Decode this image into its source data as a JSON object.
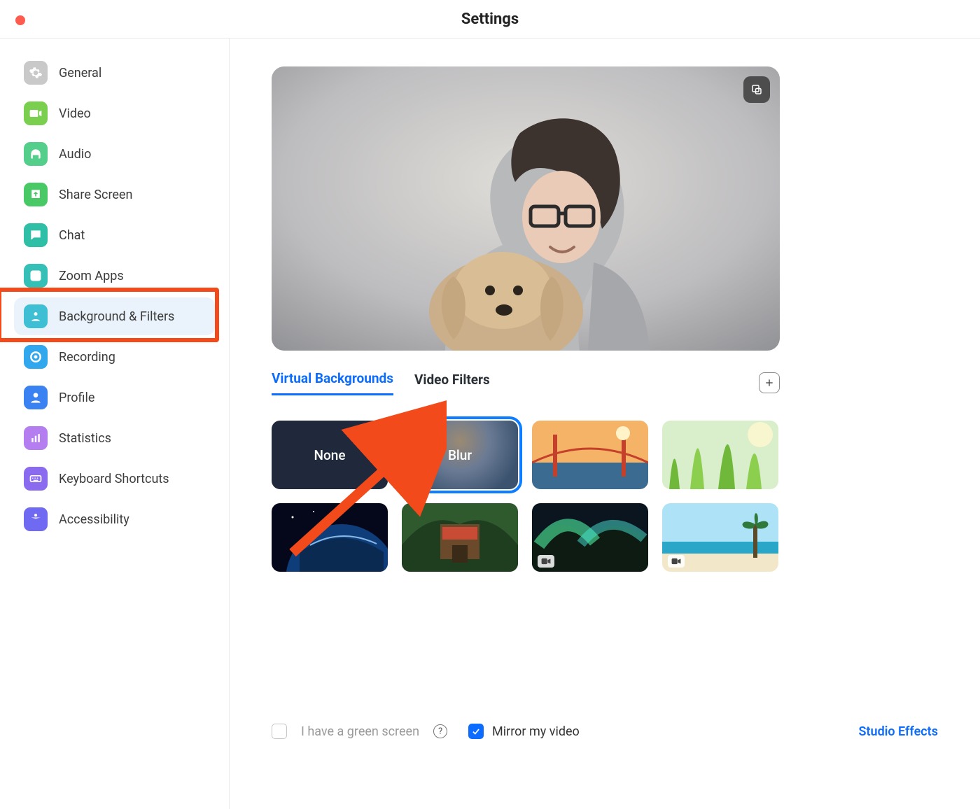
{
  "window": {
    "title": "Settings"
  },
  "sidebar": {
    "items": [
      {
        "label": "General",
        "icon": "gear",
        "color": "#c9c9c9"
      },
      {
        "label": "Video",
        "icon": "video",
        "color": "#7bcf4e"
      },
      {
        "label": "Audio",
        "icon": "headphones",
        "color": "#54cf8b"
      },
      {
        "label": "Share Screen",
        "icon": "share",
        "color": "#48c966"
      },
      {
        "label": "Chat",
        "icon": "chat",
        "color": "#2fbfa7"
      },
      {
        "label": "Zoom Apps",
        "icon": "apps",
        "color": "#35c0b7"
      },
      {
        "label": "Background & Filters",
        "icon": "person",
        "color": "#3fbfd3",
        "selected": true,
        "highlighted": true
      },
      {
        "label": "Recording",
        "icon": "target",
        "color": "#31a7ee"
      },
      {
        "label": "Profile",
        "icon": "user",
        "color": "#3a81f2"
      },
      {
        "label": "Statistics",
        "icon": "bar",
        "color": "#b47ef1"
      },
      {
        "label": "Keyboard Shortcuts",
        "icon": "keyboard",
        "color": "#8a6bf0"
      },
      {
        "label": "Accessibility",
        "icon": "accessibility",
        "color": "#6f6af1"
      }
    ]
  },
  "tabs": {
    "items": [
      {
        "label": "Virtual Backgrounds",
        "active": true
      },
      {
        "label": "Video Filters",
        "active": false
      }
    ]
  },
  "backgrounds": {
    "items": [
      {
        "kind": "none",
        "label": "None"
      },
      {
        "kind": "blur",
        "label": "Blur",
        "selected": true,
        "pointed_by_arrow": true
      },
      {
        "kind": "image",
        "name": "golden-gate-bridge"
      },
      {
        "kind": "image",
        "name": "grass"
      },
      {
        "kind": "image",
        "name": "earth-from-space"
      },
      {
        "kind": "image",
        "name": "jurassic-park-gate"
      },
      {
        "kind": "video",
        "name": "aurora"
      },
      {
        "kind": "video",
        "name": "beach"
      }
    ]
  },
  "footer": {
    "green_screen_label": "I have a green screen",
    "green_screen_checked": false,
    "mirror_label": "Mirror my video",
    "mirror_checked": true,
    "studio_effects": "Studio Effects"
  },
  "colors": {
    "accent": "#0c6cff",
    "highlight_box": "#f24a1a"
  }
}
